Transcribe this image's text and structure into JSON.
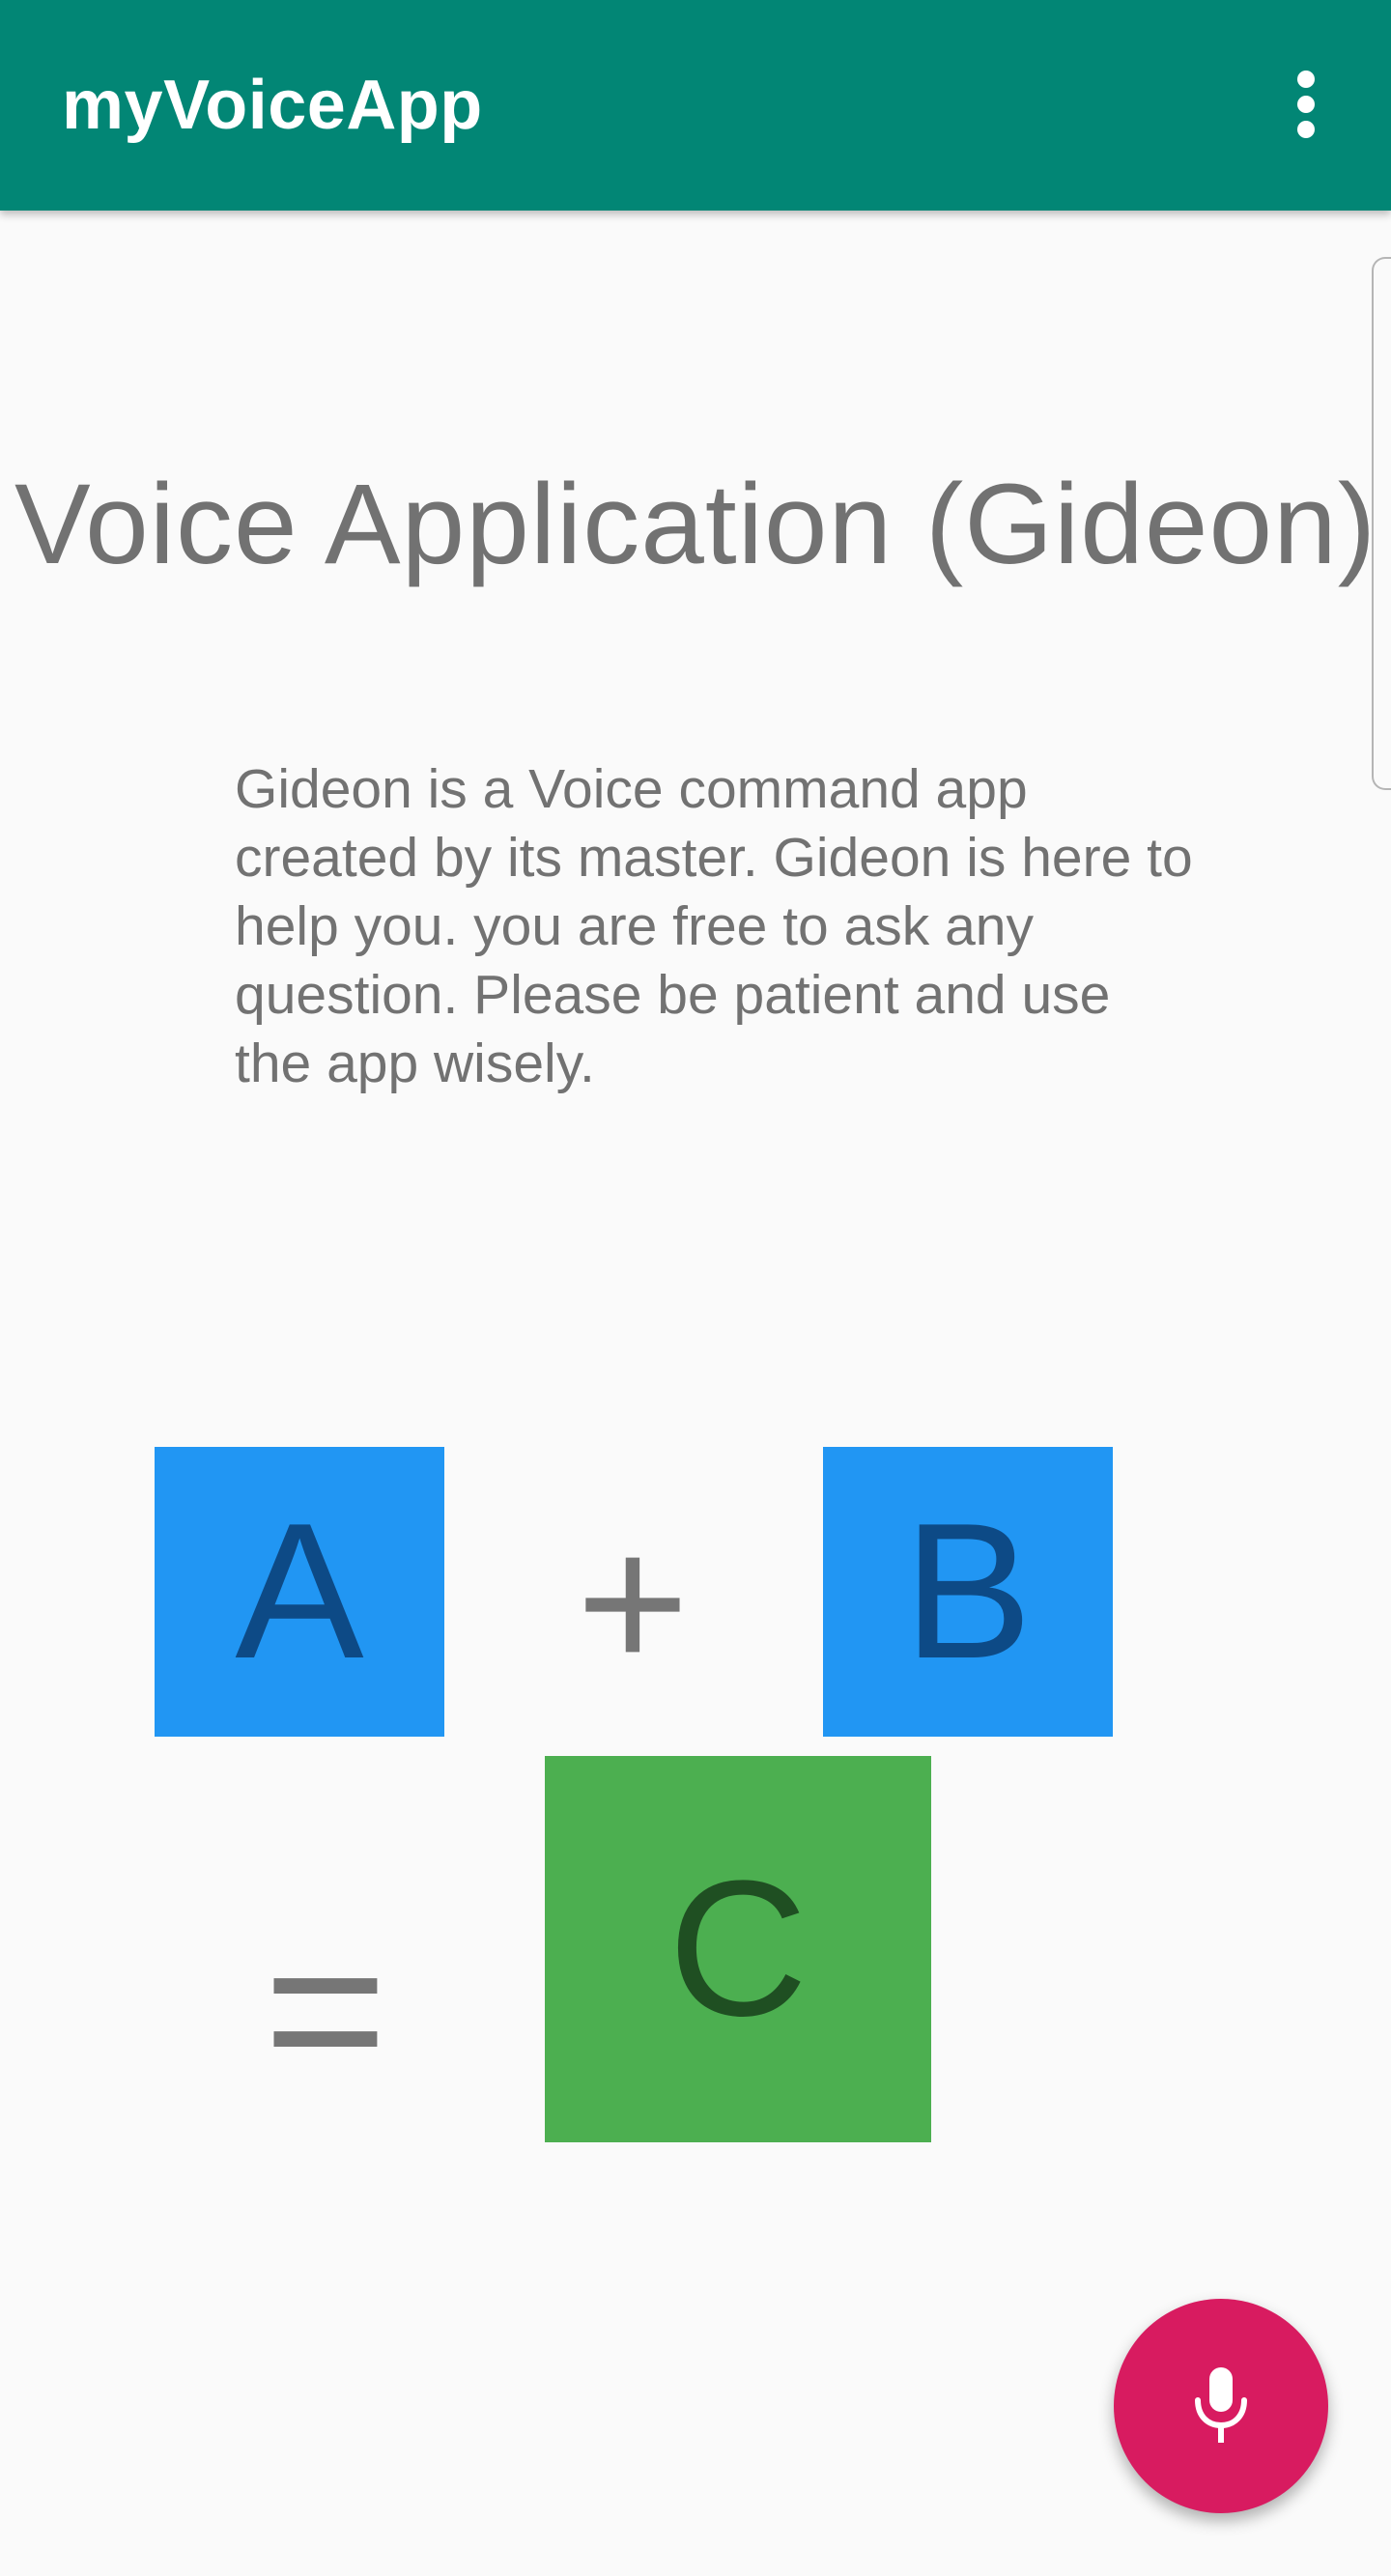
{
  "app": {
    "title": "myVoiceApp",
    "toolbar_color": "#028675",
    "overflow_icon": "more-vert-icon"
  },
  "main": {
    "heading": "Voice Application (Gideon)",
    "description": "Gideon is a Voice command app created by its master. Gideon is here to help you. you are free to ask any question. Please be patient and use the app wisely."
  },
  "equation": {
    "a_label": "A",
    "plus_sign": "+",
    "b_label": "B",
    "equals_sign": "=",
    "c_label": "C",
    "input_tile_color": "#2196f3",
    "result_tile_color": "#4caf50"
  },
  "fab": {
    "icon": "mic-icon",
    "color": "#d81b60"
  }
}
